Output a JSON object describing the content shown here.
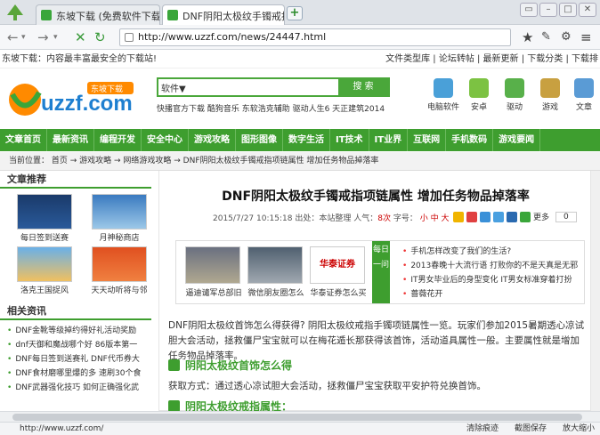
{
  "browser": {
    "tabs": [
      {
        "label": "东坡下载 (免费软件下载网站..."
      },
      {
        "label": "DNF阴阳太极纹手镯戒指项链..."
      }
    ],
    "window_buttons": [
      "▭",
      "–",
      "□",
      "✕"
    ],
    "url": "http://www.uzzf.com/news/24447.html"
  },
  "bookmarks": {
    "left": "东坡下载：内容最丰富最安全的下载站!",
    "right": "文件类型库 | 论坛转帖 | 最新更新 | 下载分类 | 下载排"
  },
  "header": {
    "search_category": "软件▼",
    "search_button": "搜 索",
    "hotlinks": "快播官方下载  酷狗音乐  东软浩克辅助  驱动人生6  天正建筑2014",
    "quick_icons": [
      {
        "label": "电脑软件",
        "icon": "computer-icon"
      },
      {
        "label": "安卓",
        "icon": "android-icon"
      },
      {
        "label": "驱动",
        "icon": "driver-icon"
      },
      {
        "label": "游戏",
        "icon": "game-icon"
      },
      {
        "label": "文章",
        "icon": "article-icon"
      }
    ]
  },
  "nav": [
    "文章首页",
    "最新资讯",
    "编程开发",
    "安全中心",
    "游戏攻略",
    "图形图像",
    "数字生活",
    "IT技术",
    "IT业界",
    "互联网",
    "手机数码",
    "游戏要闻"
  ],
  "breadcrumb": "当前位置：   首页   →  游戏攻略  →  网络游戏攻略  → DNF阴阳太极纹手镯戒指项链属性  增加任务物品掉落率",
  "sidebar": {
    "recommend_title": "文章推荐",
    "thumbs": [
      {
        "label": "每日签到送赛"
      },
      {
        "label": "月神秘商店"
      },
      {
        "label": "洛克王国捉风"
      },
      {
        "label": "天天动听将与邻"
      }
    ],
    "related_title": "相关资讯",
    "related": [
      "DNF金靴等级掉约得好礼活动奖励",
      "dnf天御和魔战哪个好 86版本第一",
      "DNF每日签到送赛礼 DNF代币券大",
      "DNF食材磨哪里爆的多 速刷30个食",
      "DNF武器强化技巧 如何正确强化武"
    ]
  },
  "article": {
    "title": "DNF阴阳太极纹手镯戒指项链属性  增加任务物品掉落率",
    "date": "2015/7/27 10:15:18",
    "source_label": "出处：",
    "source": "本站整理",
    "views_label": "人气：",
    "views": "8次",
    "font_label": "字号：",
    "font_sizes": [
      "小",
      "中",
      "大"
    ],
    "share_more": "更多",
    "share_count": "0",
    "related": [
      {
        "label": "逼迪谴军总部旧"
      },
      {
        "label": "微信朋友圈怎么"
      },
      {
        "label": "华泰证券怎么买"
      }
    ],
    "daily_label": "每日一问",
    "daily": [
      "手机怎样改变了我们的生活?",
      "2013春晚十大流行语 打败你的不是天真是无邪",
      "IT男女毕业后的身型变化 IT男女标准穿着打扮",
      "蔷薇花开"
    ],
    "para1": "DNF阴阳太极纹首饰怎么得获得? 阴阳太极纹戒指手镯项链属性一览。玩家们参加2015暑期透心凉试胆大会活动，拯救僵尸宝宝就可以在梅花遁长那获得该首饰，活动道具属性一般。主要属性就是增加任务物品掉落率。",
    "section1": "阴阳太极纹首饰怎么得",
    "para2": "获取方式：通过透心凉试胆大会活动，拯救僵尸宝宝获取平安护符兑换首饰。",
    "section2": "阴阳太极纹戒指属性："
  },
  "status": {
    "url": "http://www.uzzf.com/",
    "actions": [
      "清除痕迹",
      "截图保存",
      "放大缩小"
    ]
  }
}
